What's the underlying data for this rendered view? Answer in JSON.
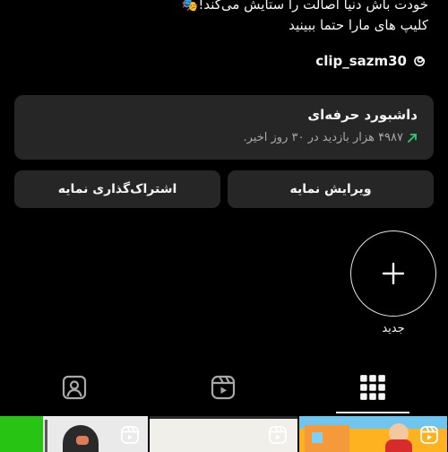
{
  "profile": {
    "bio_line_1": "خودت باش دنیا اصالت را ستایش می‌کند!🎭",
    "bio_line_2": "کلیپ های مارا حتما ببینید",
    "threads_handle": "clip_sazm30",
    "threads_icon": "threads-icon"
  },
  "dashboard": {
    "title": "داشبورد حرفه‌ای",
    "stat_text": "۴۹۸۷ هزار بازدید در ۳۰ روز اخیر.",
    "trend_icon": "trend-up-arrow-icon",
    "trend_color": "#2ecc71"
  },
  "actions": {
    "edit_label": "ویرایش نمایه",
    "share_label": "اشتراک‌گذاری نمایه"
  },
  "highlights": {
    "new_label": "جدید",
    "new_icon": "plus-icon"
  },
  "tabs": {
    "items": [
      {
        "name": "grid",
        "icon": "grid-icon",
        "active": true
      },
      {
        "name": "reels",
        "icon": "reels-icon",
        "active": false
      },
      {
        "name": "tagged",
        "icon": "tagged-person-icon",
        "active": false
      }
    ]
  },
  "colors": {
    "background": "#000000",
    "surface": "#262626",
    "text": "#f5f5f5",
    "muted": "#a8a8a8"
  }
}
